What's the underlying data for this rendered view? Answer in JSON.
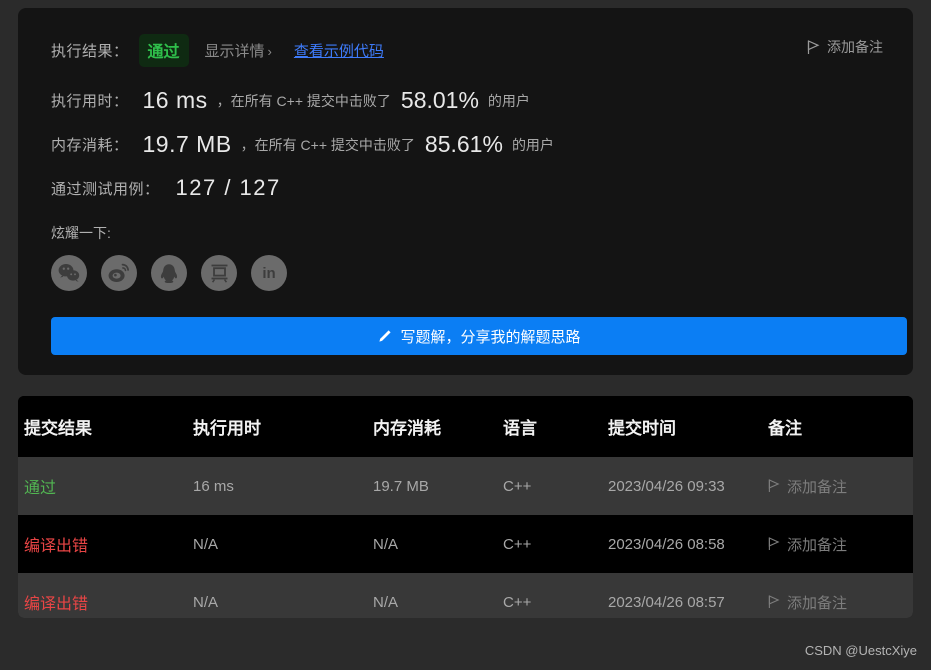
{
  "result_card": {
    "status_label": "执行结果：",
    "status_value": "通过",
    "detail_link": "显示详情",
    "detail_chevron": "›",
    "sample_code_link": "查看示例代码",
    "add_note": "添加备注",
    "runtime": {
      "label": "执行用时：",
      "value": "16 ms",
      "mid_text": "，在所有 C++ 提交中击败了",
      "percent": "58.01%",
      "suffix": "的用户"
    },
    "memory": {
      "label": "内存消耗：",
      "value": "19.7 MB",
      "mid_text": "，在所有 C++ 提交中击败了",
      "percent": "85.61%",
      "suffix": "的用户"
    },
    "testcases": {
      "label": "通过测试用例：",
      "value": "127 / 127"
    },
    "share": {
      "label": "炫耀一下:",
      "icons": [
        {
          "name": "wechat-icon",
          "title": "微信"
        },
        {
          "name": "weibo-icon",
          "title": "微博"
        },
        {
          "name": "qq-icon",
          "title": "QQ"
        },
        {
          "name": "douban-icon",
          "title": "豆瓣",
          "glyph": "豆"
        },
        {
          "name": "linkedin-icon",
          "title": "LinkedIn",
          "glyph": "in"
        }
      ]
    },
    "solution_button": "写题解，分享我的解题思路"
  },
  "submissions_table": {
    "columns": [
      "提交结果",
      "执行用时",
      "内存消耗",
      "语言",
      "提交时间",
      "备注"
    ],
    "rows": [
      {
        "status": "通过",
        "status_type": "pass",
        "runtime": "16 ms",
        "memory": "19.7 MB",
        "language": "C++",
        "time": "2023/04/26 09:33",
        "note": "添加备注"
      },
      {
        "status": "编译出错",
        "status_type": "error",
        "runtime": "N/A",
        "memory": "N/A",
        "language": "C++",
        "time": "2023/04/26 08:58",
        "note": "添加备注"
      },
      {
        "status": "编译出错",
        "status_type": "error",
        "runtime": "N/A",
        "memory": "N/A",
        "language": "C++",
        "time": "2023/04/26 08:57",
        "note": "添加备注"
      }
    ]
  },
  "watermark": "CSDN @UestcXiye",
  "colors": {
    "page_bg": "#2b2b2b",
    "card_bg": "#141414",
    "accent_blue": "#0b7ef4",
    "link_blue": "#3e7bfa",
    "pass_green": "#2fbf4b",
    "error_red": "#e84545",
    "row_alt": "#383838"
  }
}
